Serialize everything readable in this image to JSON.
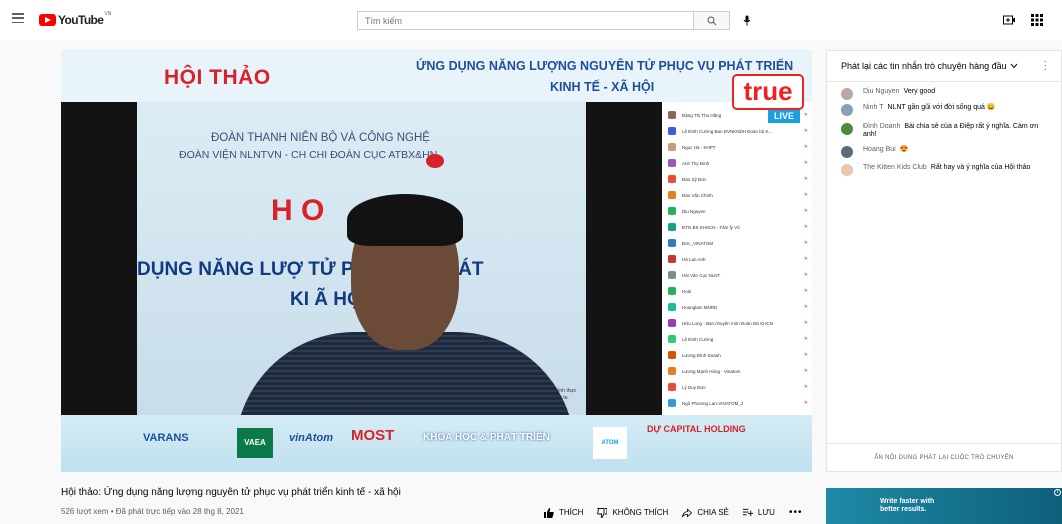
{
  "header": {
    "logo_text": "YouTube",
    "logo_country": "VN",
    "search_placeholder": "Tìm kiếm"
  },
  "player": {
    "banner_left": "HỘI THẢO",
    "banner_right_line1": "ỨNG DỤNG NĂNG LƯỢNG NGUYÊN TỬ PHỤC VỤ PHÁT TRIỂN",
    "banner_right_line2": "KINH TẾ - XÃ HỘI",
    "stage_line1": "ĐOÀN THANH NIÊN BỘ                VÀ CÔNG NGHỆ",
    "stage_line2": "ĐOÀN VIỆN NLNTVN - CH                   CHI ĐOÀN CỤC ATBX&HN",
    "stage_hoi": "H         O",
    "stage_line3": "DỤNG NĂNG LƯỢ                  TỬ PHỤC VỤ PHÁT",
    "stage_line4": "KI              Ã HỘI",
    "stage_note": "Chương trình thực\nto huấn trực tu",
    "true_logo": "true",
    "live_label": "LIVE",
    "participants": [
      "Đặng Thị Thu Hằng",
      "Lê Đình Cường Ban ĐVNKNDH Đoàn bộ K...",
      "Ngọc Hà - KHPT",
      "Anh Thy Đinh",
      "Đào Sỹ Đức",
      "Đào Văn Chính",
      "Dịu Nguyen",
      "ĐTN BS KHSCN - Tâm lý Vũ",
      "Đức_VINATOM",
      "Hà Lan Anh",
      "Hải Vân Cục NLNT",
      "Hoài",
      "Hoanglam MNRD",
      "Hữu Long - Ban chuyên môn Đoàn BS KHCN",
      "Lê Đình Cường",
      "Lương Đình Doanh",
      "Lương Mạnh Hùng - Vinatom",
      "Lý Duy Đức",
      "Ngô Phương Lan-VINATOM_2"
    ],
    "sponsors": [
      "VARANS",
      "VAEA",
      "vinAtom",
      "MOST",
      "KHOA HỌC & PHÁT TRIỂN",
      "ATOM",
      "DỰ CAPITAL HOLDING"
    ]
  },
  "video": {
    "title": "Hội thảo: Ứng dụng năng lượng nguyên tử phục vụ phát triển kinh tế - xã hội",
    "meta": "526 lượt xem • Đã phát trực tiếp vào 28 thg 8, 2021",
    "actions": {
      "like": "THÍCH",
      "dislike": "KHÔNG THÍCH",
      "share": "CHIA SẺ",
      "save": "LƯU"
    }
  },
  "chat": {
    "header": "Phát lại các tin nhắn trò chuyện hàng đầu",
    "messages": [
      {
        "author": "Dịu Nguyen",
        "text": "Very good",
        "emoji": ""
      },
      {
        "author": "Ninh T",
        "text": "NLNT gần gũi với đời sống quá",
        "emoji": "😀"
      },
      {
        "author": "Đình Doanh",
        "text": "Bài chia sẻ của a Điệp rất ý nghĩa. Cảm ơn anh!",
        "emoji": ""
      },
      {
        "author": "Hoang Bui",
        "text": "",
        "emoji": "😍"
      },
      {
        "author": "The Kitten Kids Club",
        "text": "Rất hay và ý nghĩa của Hội thảo",
        "emoji": ""
      }
    ],
    "footer": "ẨN NỘI DUNG PHÁT LẠI CUỘC TRÒ CHUYỆN"
  },
  "ad": {
    "text": "Write faster with better results."
  },
  "colors": {
    "brand_red": "#ff0000",
    "banner_red": "#d8212a",
    "banner_blue": "#1d4f9c"
  }
}
